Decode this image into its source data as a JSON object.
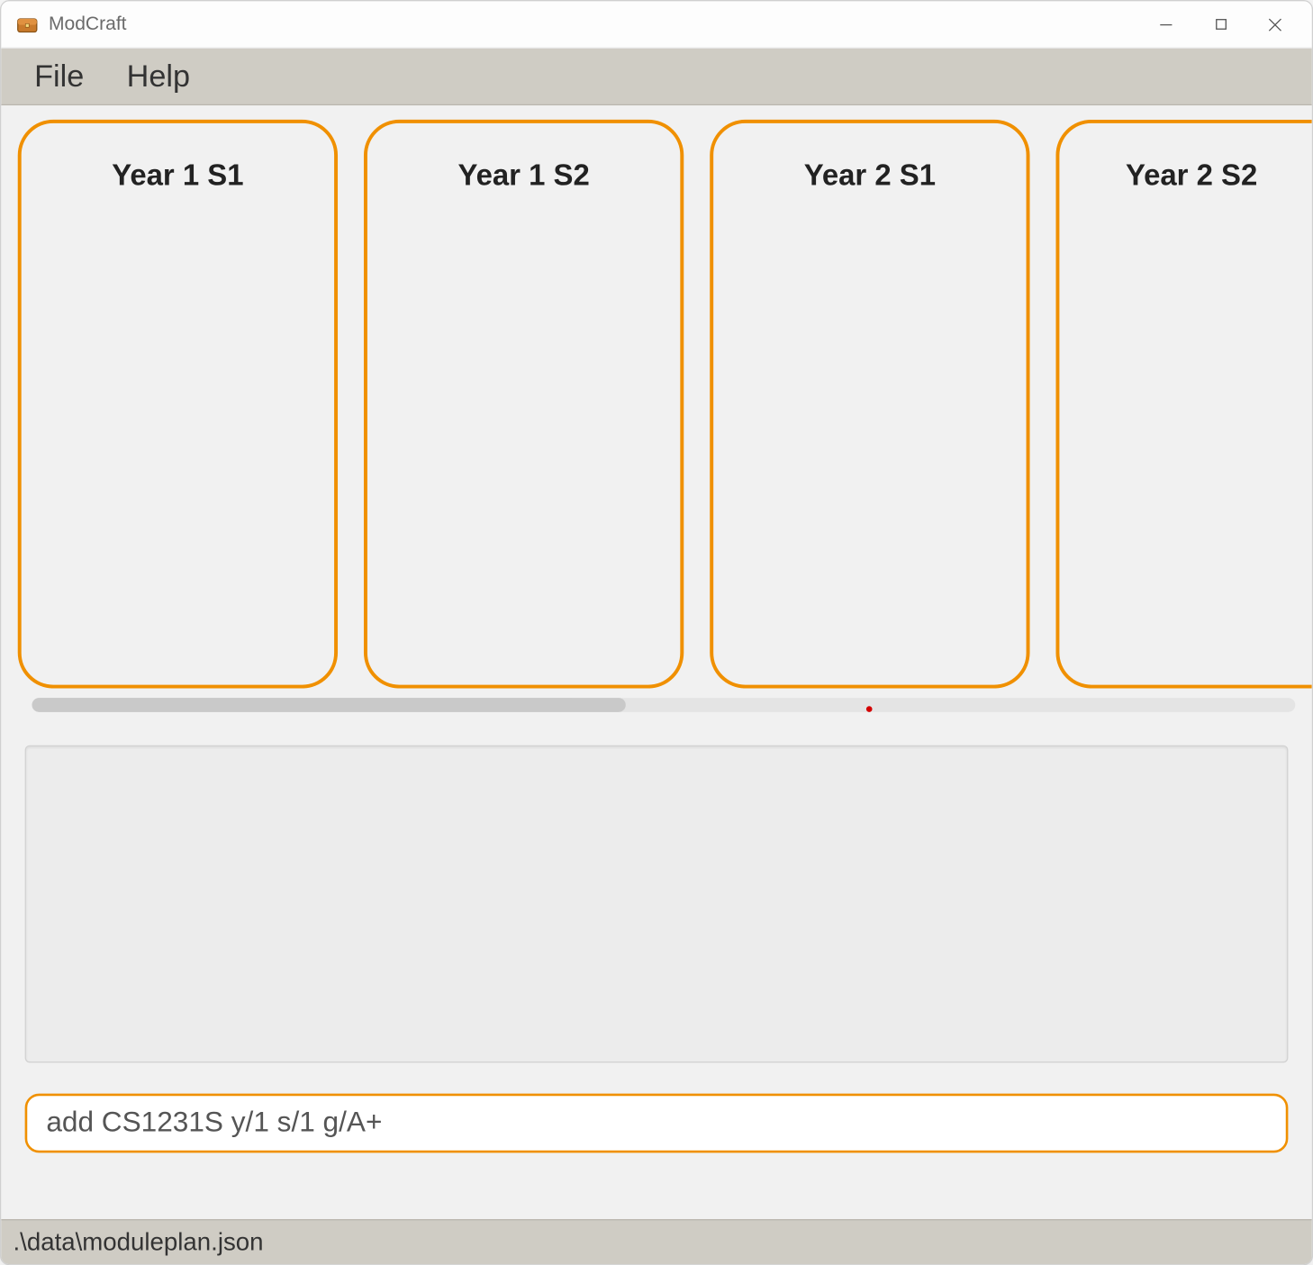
{
  "window": {
    "title": "ModCraft",
    "icon": "chest-icon"
  },
  "menubar": {
    "items": [
      "File",
      "Help"
    ]
  },
  "semesters": [
    {
      "title": "Year 1 S1"
    },
    {
      "title": "Year 1 S2"
    },
    {
      "title": "Year 2 S1"
    },
    {
      "title": "Year 2 S2"
    }
  ],
  "output_panel_text": "",
  "command_input": {
    "value": "add CS1231S y/1 s/1 g/A+"
  },
  "statusbar": {
    "path": ".\\data\\moduleplan.json"
  },
  "colors": {
    "accent": "#f09000",
    "menubar_bg": "#cfccc4",
    "content_bg": "#f1f1f1"
  }
}
